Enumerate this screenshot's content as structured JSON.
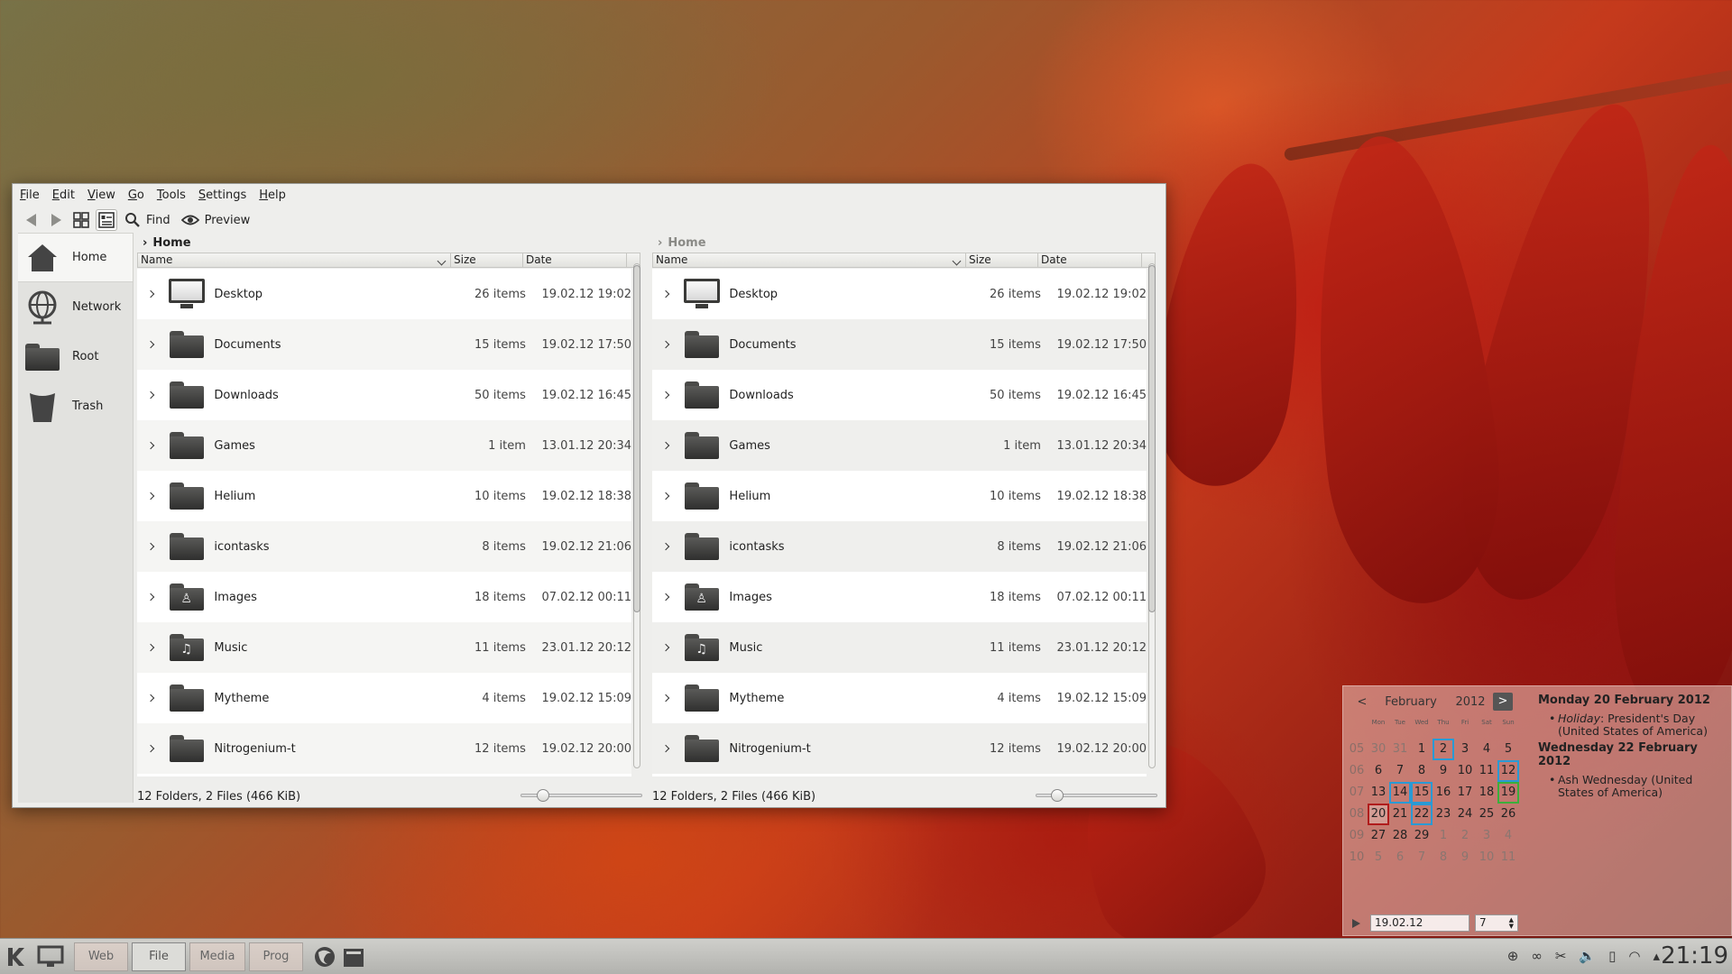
{
  "menubar": [
    "File",
    "Edit",
    "View",
    "Go",
    "Tools",
    "Settings",
    "Help"
  ],
  "toolbar": {
    "find_label": "Find",
    "preview_label": "Preview"
  },
  "places": [
    {
      "label": "Home",
      "icon": "home-icon"
    },
    {
      "label": "Network",
      "icon": "network-icon"
    },
    {
      "label": "Root",
      "icon": "folder-icon"
    },
    {
      "label": "Trash",
      "icon": "trash-icon"
    }
  ],
  "left_pane": {
    "breadcrumb": "Home",
    "columns": {
      "name": "Name",
      "size": "Size",
      "date": "Date"
    },
    "status": "12 Folders, 2 Files (466 KiB)"
  },
  "right_pane": {
    "breadcrumb": "Home",
    "columns": {
      "name": "Name",
      "size": "Size",
      "date": "Date"
    },
    "status": "12 Folders, 2 Files (466 KiB)"
  },
  "files": [
    {
      "name": "Desktop",
      "size": "26 items",
      "date": "19.02.12 19:02",
      "icon": "monitor-icon"
    },
    {
      "name": "Documents",
      "size": "15 items",
      "date": "19.02.12 17:50",
      "icon": "folder-icon"
    },
    {
      "name": "Downloads",
      "size": "50 items",
      "date": "19.02.12 16:45",
      "icon": "folder-icon"
    },
    {
      "name": "Games",
      "size": "1 item",
      "date": "13.01.12 20:34",
      "icon": "folder-icon"
    },
    {
      "name": "Helium",
      "size": "10 items",
      "date": "19.02.12 18:38",
      "icon": "folder-icon"
    },
    {
      "name": "icontasks",
      "size": "8 items",
      "date": "19.02.12 21:06",
      "icon": "folder-icon"
    },
    {
      "name": "Images",
      "size": "18 items",
      "date": "07.02.12 00:11",
      "icon": "folder-images-icon"
    },
    {
      "name": "Music",
      "size": "11 items",
      "date": "23.01.12 20:12",
      "icon": "folder-music-icon"
    },
    {
      "name": "Mytheme",
      "size": "4 items",
      "date": "19.02.12 15:09",
      "icon": "folder-icon"
    },
    {
      "name": "Nitrogenium-t",
      "size": "12 items",
      "date": "19.02.12 20:00",
      "icon": "folder-icon"
    }
  ],
  "calendar": {
    "month": "February",
    "year": "2012",
    "prev": "<",
    "next": ">",
    "day_headers": [
      "Mon",
      "Tue",
      "Wed",
      "Thu",
      "Fri",
      "Sat",
      "Sun"
    ],
    "weeks": [
      {
        "wk": "05",
        "days": [
          "30",
          "31",
          "1",
          "2",
          "3",
          "4",
          "5"
        ]
      },
      {
        "wk": "06",
        "days": [
          "6",
          "7",
          "8",
          "9",
          "10",
          "11",
          "12"
        ]
      },
      {
        "wk": "07",
        "days": [
          "13",
          "14",
          "15",
          "16",
          "17",
          "18",
          "19"
        ]
      },
      {
        "wk": "08",
        "days": [
          "20",
          "21",
          "22",
          "23",
          "24",
          "25",
          "26"
        ]
      },
      {
        "wk": "09",
        "days": [
          "27",
          "28",
          "29",
          "1",
          "2",
          "3",
          "4"
        ]
      },
      {
        "wk": "10",
        "days": [
          "5",
          "6",
          "7",
          "8",
          "9",
          "10",
          "11"
        ]
      }
    ],
    "date_input": "19.02.12",
    "week_input": "7",
    "events": [
      {
        "date": "Monday 20 February 2012",
        "items": [
          {
            "kind": "Holiday",
            "text": ": President's Day (United States of America)"
          }
        ]
      },
      {
        "date": "Wednesday 22 February 2012",
        "items": [
          {
            "kind": "",
            "text": "Ash Wednesday (United States of America)"
          }
        ]
      }
    ]
  },
  "taskbar": {
    "buttons": [
      "Web",
      "File",
      "Media",
      "Prog"
    ],
    "clock": "21:19"
  },
  "colors": {
    "event_outline": "#2a9ad4",
    "today_outline": "#3cae3c",
    "selected_outline": "#b01c1c"
  }
}
